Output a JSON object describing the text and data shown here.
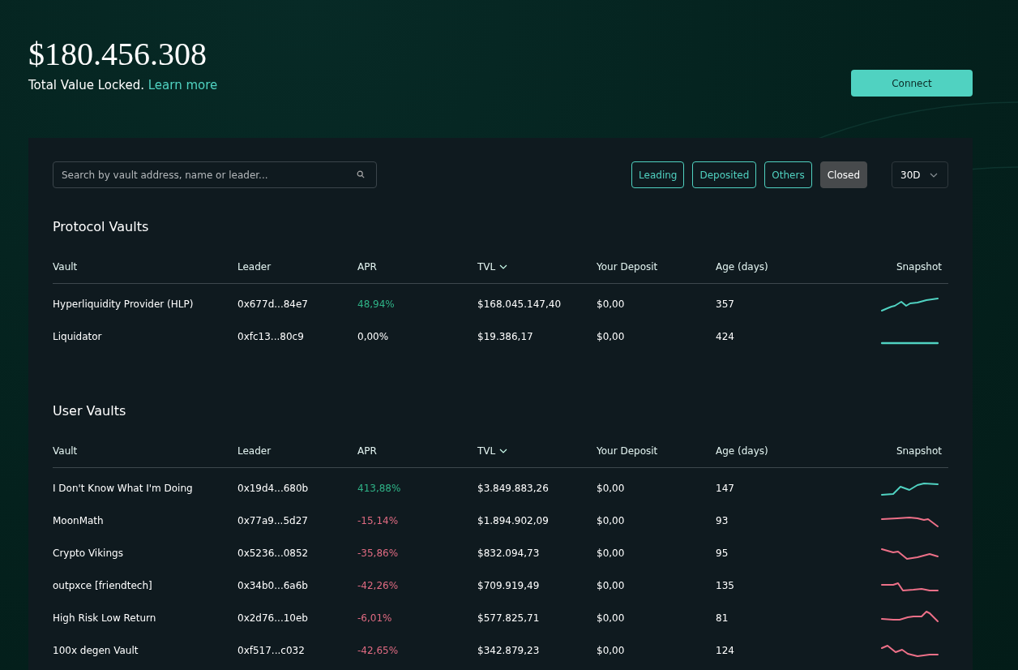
{
  "header": {
    "total_value": "$180.456.308",
    "caption": "Total Value Locked.",
    "learn_more_link": "Learn more",
    "connect_button": "Connect"
  },
  "toolbar": {
    "search": {
      "placeholder": "Search by vault address, name or leader..."
    },
    "filters": [
      {
        "label": "Leading",
        "selected": false
      },
      {
        "label": "Deposited",
        "selected": false
      },
      {
        "label": "Others",
        "selected": false
      },
      {
        "label": "Closed",
        "selected": true
      }
    ],
    "period": "30D"
  },
  "sections": [
    {
      "title": "Protocol Vaults",
      "columns": [
        {
          "label": "Vault",
          "sorted": false
        },
        {
          "label": "Leader",
          "sorted": false
        },
        {
          "label": "APR",
          "sorted": false
        },
        {
          "label": "TVL",
          "sorted": true
        },
        {
          "label": "Your Deposit",
          "sorted": false
        },
        {
          "label": "Age (days)",
          "sorted": false
        },
        {
          "label": "Snapshot",
          "sorted": false
        }
      ],
      "rows": [
        {
          "vault": "Hyperliquidity Provider (HLP)",
          "leader": "0x677d...84e7",
          "apr": {
            "text": "48,94%",
            "color": "#2fb387"
          },
          "tvl": "$168.045.147,40",
          "deposit": "$0,00",
          "age": "357",
          "snapshot": {
            "color": "#50d2c1"
          }
        },
        {
          "vault": "Liquidator",
          "leader": "0xfc13...80c9",
          "apr": {
            "text": "0,00%",
            "color": "#ffffff"
          },
          "tvl": "$19.386,17",
          "deposit": "$0,00",
          "age": "424",
          "snapshot": {
            "color": "#50d2c1"
          }
        }
      ]
    },
    {
      "title": "User Vaults",
      "columns": [
        {
          "label": "Vault",
          "sorted": false
        },
        {
          "label": "Leader",
          "sorted": false
        },
        {
          "label": "APR",
          "sorted": false
        },
        {
          "label": "TVL",
          "sorted": true
        },
        {
          "label": "Your Deposit",
          "sorted": false
        },
        {
          "label": "Age (days)",
          "sorted": false
        },
        {
          "label": "Snapshot",
          "sorted": false
        }
      ],
      "rows": [
        {
          "vault": "I Don't Know What I'm Doing",
          "leader": "0x19d4...680b",
          "apr": {
            "text": "413,88%",
            "color": "#2fb387"
          },
          "tvl": "$3.849.883,26",
          "deposit": "$0,00",
          "age": "147",
          "snapshot": {
            "color": "#50d2c1"
          }
        },
        {
          "vault": "MoonMath",
          "leader": "0x77a9...5d27",
          "apr": {
            "text": "-15,14%",
            "color": "#e06b82"
          },
          "tvl": "$1.894.902,09",
          "deposit": "$0,00",
          "age": "93",
          "snapshot": {
            "color": "#ed7088"
          }
        },
        {
          "vault": "Crypto Vikings",
          "leader": "0x5236...0852",
          "apr": {
            "text": "-35,86%",
            "color": "#e06b82"
          },
          "tvl": "$832.094,73",
          "deposit": "$0,00",
          "age": "95",
          "snapshot": {
            "color": "#ed7088"
          }
        },
        {
          "vault": "outpxce [friendtech]",
          "leader": "0x34b0...6a6b",
          "apr": {
            "text": "-42,26%",
            "color": "#e06b82"
          },
          "tvl": "$709.919,49",
          "deposit": "$0,00",
          "age": "135",
          "snapshot": {
            "color": "#ed7088"
          }
        },
        {
          "vault": "High Risk Low Return",
          "leader": "0x2d76...10eb",
          "apr": {
            "text": "-6,01%",
            "color": "#e06b82"
          },
          "tvl": "$577.825,71",
          "deposit": "$0,00",
          "age": "81",
          "snapshot": {
            "color": "#ed7088"
          }
        },
        {
          "vault": "100x degen Vault",
          "leader": "0xf517...c032",
          "apr": {
            "text": "-42,65%",
            "color": "#e06b82"
          },
          "tvl": "$342.879,23",
          "deposit": "$0,00",
          "age": "124",
          "snapshot": {
            "color": "#ed7088"
          }
        }
      ]
    }
  ]
}
